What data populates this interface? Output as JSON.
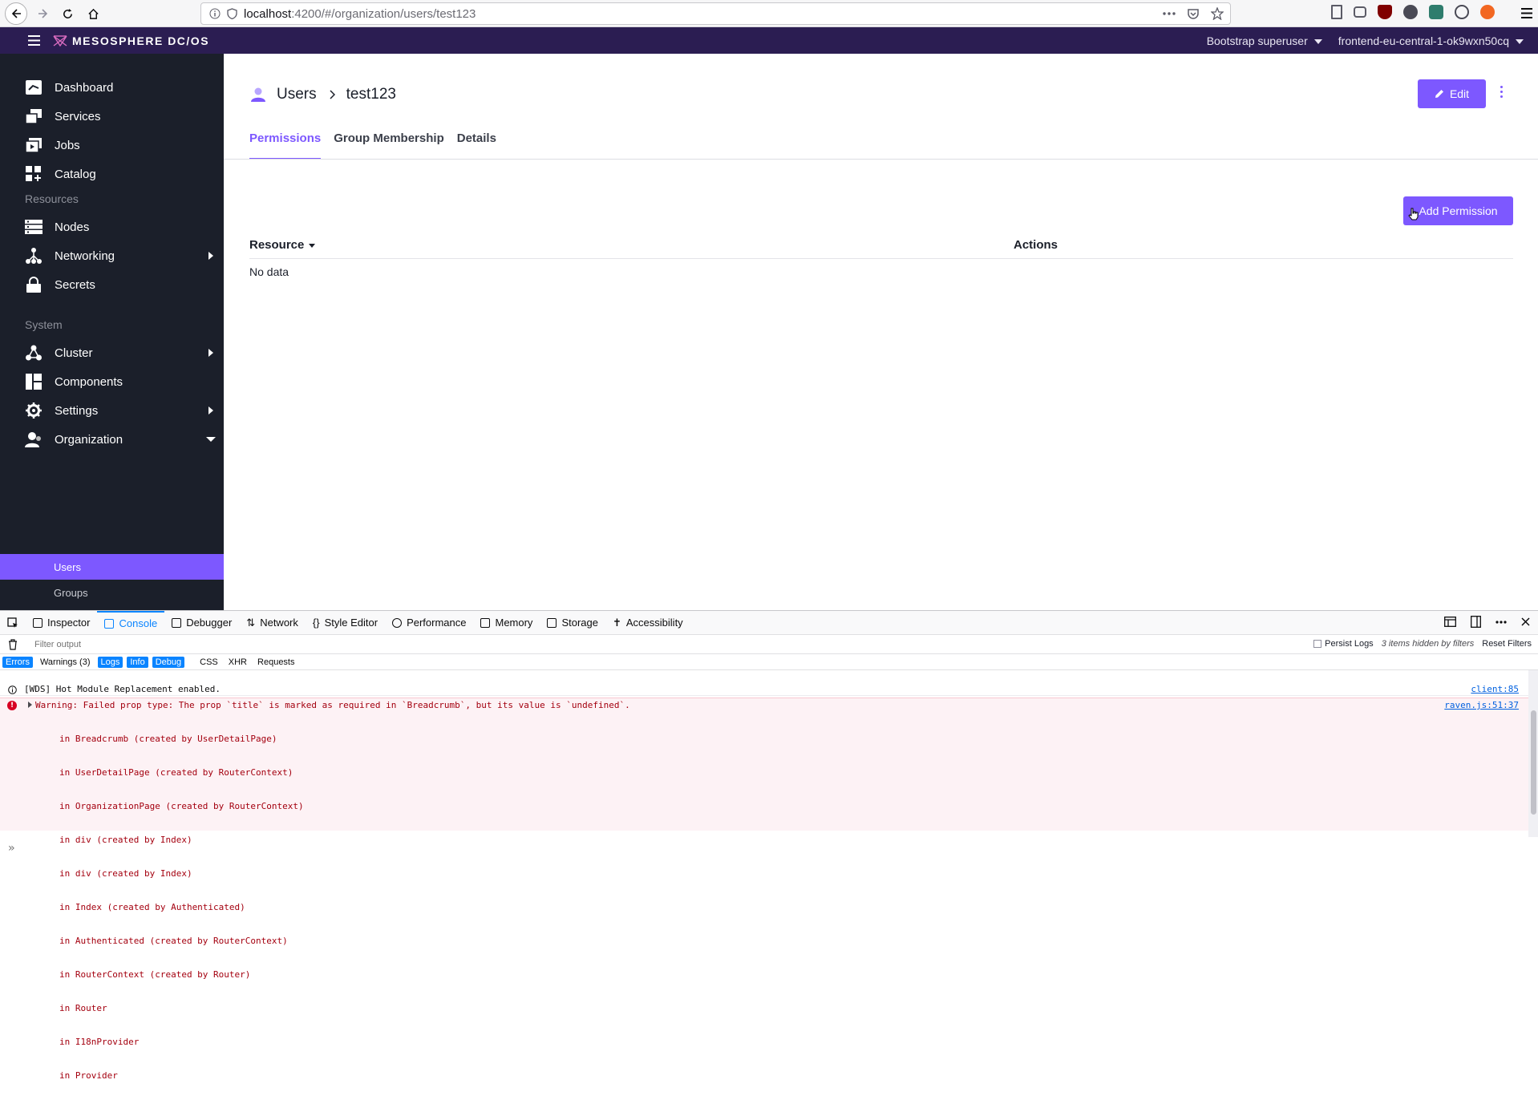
{
  "browser": {
    "url_host": "localhost",
    "url_rest": ":4200/#/organization/users/test123"
  },
  "appbar": {
    "brand": "MESOSPHERE DC/OS",
    "user_menu": "Bootstrap superuser",
    "cluster_menu": "frontend-eu-central-1-ok9wxn50cq"
  },
  "sidebar": {
    "items": [
      {
        "label": "Dashboard"
      },
      {
        "label": "Services"
      },
      {
        "label": "Jobs"
      },
      {
        "label": "Catalog"
      },
      {
        "label": "Nodes"
      },
      {
        "label": "Networking"
      },
      {
        "label": "Secrets"
      },
      {
        "label": "Cluster"
      },
      {
        "label": "Components"
      },
      {
        "label": "Settings"
      },
      {
        "label": "Organization"
      }
    ],
    "sections": {
      "resources": "Resources",
      "system": "System"
    },
    "sub_items": [
      {
        "label": "Users"
      },
      {
        "label": "Groups"
      }
    ],
    "active_color": "#7d58ff"
  },
  "main": {
    "breadcrumb": {
      "parent": "Users",
      "current": "test123"
    },
    "edit_label": "Edit",
    "tabs": [
      {
        "label": "Permissions"
      },
      {
        "label": "Group Membership"
      },
      {
        "label": "Details"
      }
    ],
    "add_permission_label": "Add Permission",
    "table": {
      "col_resource": "Resource",
      "col_actions": "Actions",
      "empty": "No data"
    },
    "accent": "#7d58ff"
  },
  "devtools": {
    "tabs": [
      {
        "label": "Inspector"
      },
      {
        "label": "Console"
      },
      {
        "label": "Debugger"
      },
      {
        "label": "Network"
      },
      {
        "label": "Style Editor"
      },
      {
        "label": "Performance"
      },
      {
        "label": "Memory"
      },
      {
        "label": "Storage"
      },
      {
        "label": "Accessibility"
      }
    ],
    "filter_placeholder": "Filter output",
    "persist_logs": "Persist Logs",
    "hidden_note": "3 items hidden by filters",
    "reset_filters": "Reset Filters",
    "levels": [
      "Errors",
      "Warnings (3)",
      "Logs",
      "Info",
      "Debug"
    ],
    "types": [
      "CSS",
      "XHR",
      "Requests"
    ],
    "logs": {
      "info_msg": "[WDS] Hot Module Replacement enabled.",
      "info_src": "client:85",
      "error_msg": "Warning: Failed prop type: The prop `title` is marked as required in `Breadcrumb`, but its value is `undefined`.",
      "error_src": "raven.js:51:37",
      "error_stack": [
        "in Breadcrumb (created by UserDetailPage)",
        "in UserDetailPage (created by RouterContext)",
        "in OrganizationPage (created by RouterContext)",
        "in div (created by Index)",
        "in div (created by Index)",
        "in Index (created by Authenticated)",
        "in Authenticated (created by RouterContext)",
        "in RouterContext (created by Router)",
        "in Router",
        "in I18nProvider",
        "in Provider"
      ]
    },
    "prompt": "»"
  }
}
